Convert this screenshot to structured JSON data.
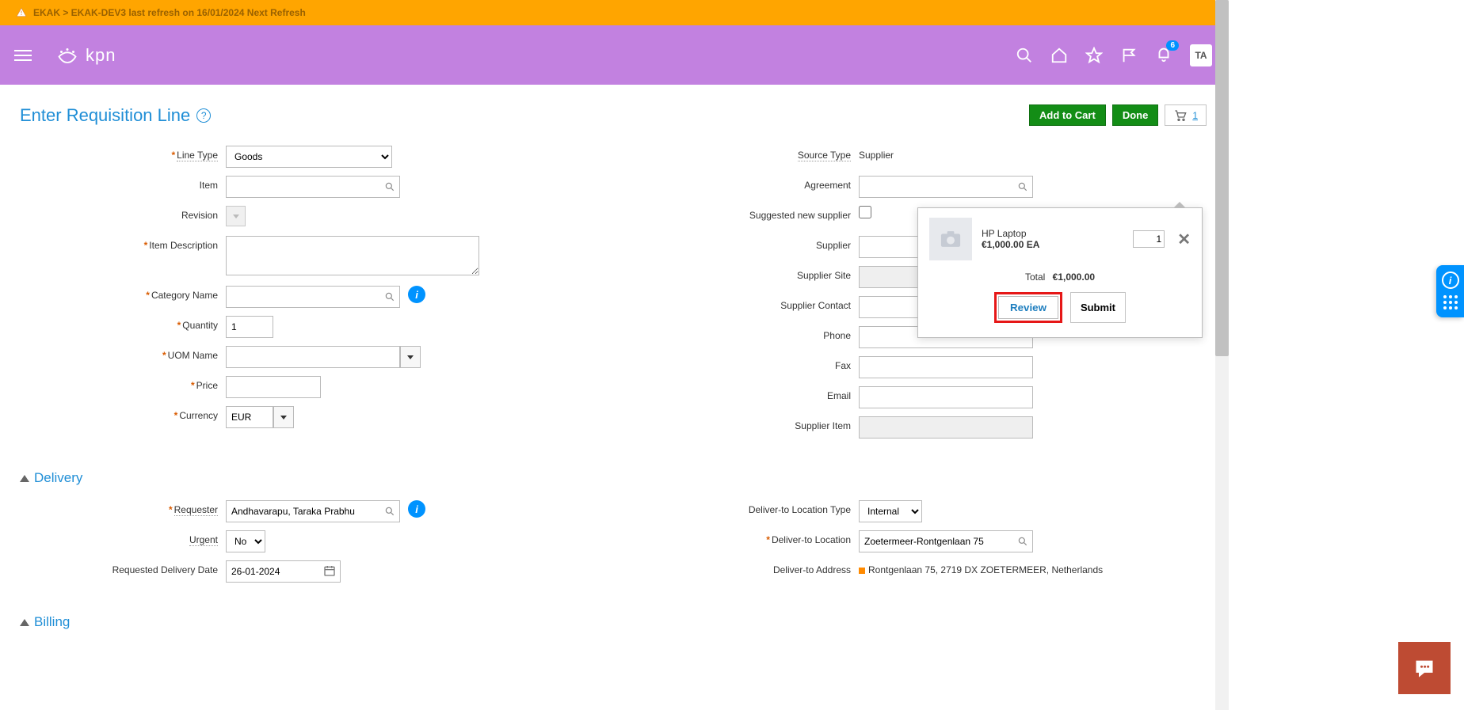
{
  "notify": {
    "text": "EKAK > EKAK-DEV3 last refresh on 16/01/2024 Next Refresh"
  },
  "brand": {
    "text": "kpn"
  },
  "header": {
    "bell_badge": "6",
    "avatar": "TA"
  },
  "page": {
    "title": "Enter Requisition Line"
  },
  "actions": {
    "add_to_cart": "Add to Cart",
    "done": "Done",
    "cart_count": "1"
  },
  "left": {
    "line_type_label": "Line Type",
    "line_type_value": "Goods",
    "item_label": "Item",
    "item_value": "",
    "revision_label": "Revision",
    "item_desc_label": "Item Description",
    "item_desc_value": "",
    "category_label": "Category Name",
    "category_value": "",
    "quantity_label": "Quantity",
    "quantity_value": "1",
    "uom_label": "UOM Name",
    "uom_value": "",
    "price_label": "Price",
    "price_value": "",
    "currency_label": "Currency",
    "currency_value": "EUR"
  },
  "right": {
    "source_type_label": "Source Type",
    "source_type_value": "Supplier",
    "agreement_label": "Agreement",
    "agreement_value": "",
    "suggested_new_supplier_label": "Suggested new supplier",
    "supplier_label": "Supplier",
    "supplier_value": "",
    "supplier_site_label": "Supplier Site",
    "supplier_site_value": "",
    "supplier_contact_label": "Supplier Contact",
    "supplier_contact_value": "",
    "phone_label": "Phone",
    "phone_value": "",
    "fax_label": "Fax",
    "fax_value": "",
    "email_label": "Email",
    "email_value": "",
    "supplier_item_label": "Supplier Item",
    "supplier_item_value": ""
  },
  "sections": {
    "delivery": "Delivery",
    "billing": "Billing"
  },
  "delivery_left": {
    "requester_label": "Requester",
    "requester_value": "Andhavarapu, Taraka Prabhu",
    "urgent_label": "Urgent",
    "urgent_value": "No",
    "req_date_label": "Requested Delivery Date",
    "req_date_value": "26-01-2024"
  },
  "delivery_right": {
    "loc_type_label": "Deliver-to Location Type",
    "loc_type_value": "Internal",
    "loc_label": "Deliver-to Location",
    "loc_value": "Zoetermeer-Rontgenlaan 75",
    "addr_label": "Deliver-to Address",
    "addr_value": "Rontgenlaan 75, 2719 DX ZOETERMEER, Netherlands"
  },
  "popover": {
    "item_name": "HP Laptop",
    "item_price": "€1,000.00 EA",
    "qty": "1",
    "total_label": "Total",
    "total_value": "€1,000.00",
    "review": "Review",
    "submit": "Submit"
  }
}
